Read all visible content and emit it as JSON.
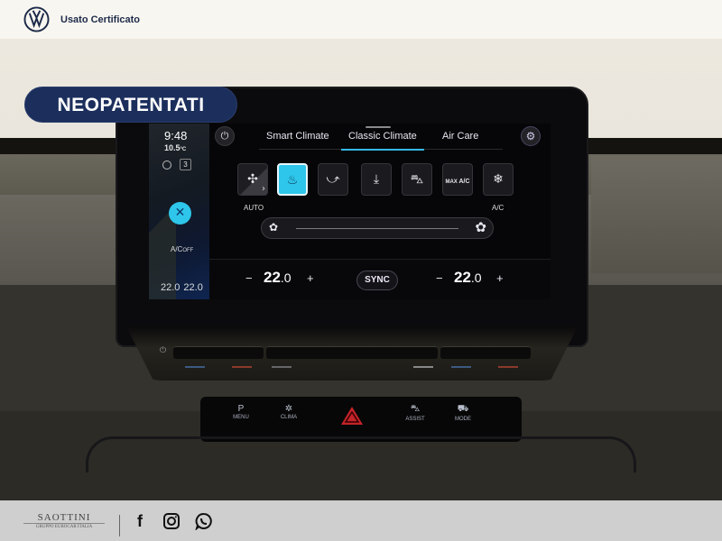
{
  "header": {
    "brand_icon": "vw-logo-icon",
    "title": "Usato Certificato"
  },
  "badge": {
    "label": "NEOPATENTATI",
    "color": "#1c2f5c"
  },
  "infotainment": {
    "status": {
      "time": "9:48",
      "outside_temp": "10.5",
      "outside_temp_unit": "°C",
      "recirculation_icon": "recirculation-icon",
      "seat_level": "3",
      "ac_off_label": "A/C",
      "ac_off_suffix": "OFF",
      "left_temps": [
        "22.0",
        "22.0"
      ]
    },
    "tabs": [
      {
        "label": "Smart Climate",
        "active": false
      },
      {
        "label": "Classic Climate",
        "active": true
      },
      {
        "label": "Air Care",
        "active": false
      }
    ],
    "accent_color": "#2ec6ea",
    "mode_buttons": [
      {
        "name": "auto-fan",
        "icon": "fan-icon",
        "label": "AUTO",
        "active": false
      },
      {
        "name": "defrost-windshield",
        "icon": "windshield-defrost-icon",
        "label": "",
        "active": true
      },
      {
        "name": "airflow-upper",
        "icon": "airflow-upper-body-icon",
        "label": "",
        "active": false
      },
      {
        "name": "airflow-feet",
        "icon": "airflow-feet-icon",
        "label": "",
        "active": false
      },
      {
        "name": "recirculation",
        "icon": "car-recirculation-icon",
        "label": "",
        "active": false
      },
      {
        "name": "max-ac",
        "icon": "max-ac-icon",
        "text_small": "MAX",
        "text_big": "A/C",
        "label": "",
        "active": false
      },
      {
        "name": "ac",
        "icon": "snowflake-icon",
        "label": "A/C",
        "active": false
      }
    ],
    "fan_slider": {
      "min_icon": "fan-small-icon",
      "max_icon": "fan-large-icon"
    },
    "temperature": {
      "driver_int": "22",
      "driver_dec": ".0",
      "passenger_int": "22",
      "passenger_dec": ".0",
      "minus": "−",
      "plus": "+",
      "sync_label": "SYNC"
    }
  },
  "console_buttons": [
    {
      "label": "MENU",
      "icon": "parking-menu-icon",
      "glyph": "P"
    },
    {
      "label": "CLIMA",
      "icon": "climate-icon",
      "glyph": "✲"
    },
    {
      "label": "ASSIST",
      "icon": "assist-icon",
      "glyph": "⛍"
    },
    {
      "label": "MODE",
      "icon": "drive-mode-icon",
      "glyph": "⛟"
    }
  ],
  "footer": {
    "dealer_name": "SAOTTINI",
    "dealer_sub": "GRUPPO EUROCAR ITALIA",
    "social": [
      {
        "name": "facebook",
        "glyph": "f"
      },
      {
        "name": "instagram",
        "glyph": "◎"
      },
      {
        "name": "whatsapp",
        "glyph": "✆"
      }
    ]
  }
}
